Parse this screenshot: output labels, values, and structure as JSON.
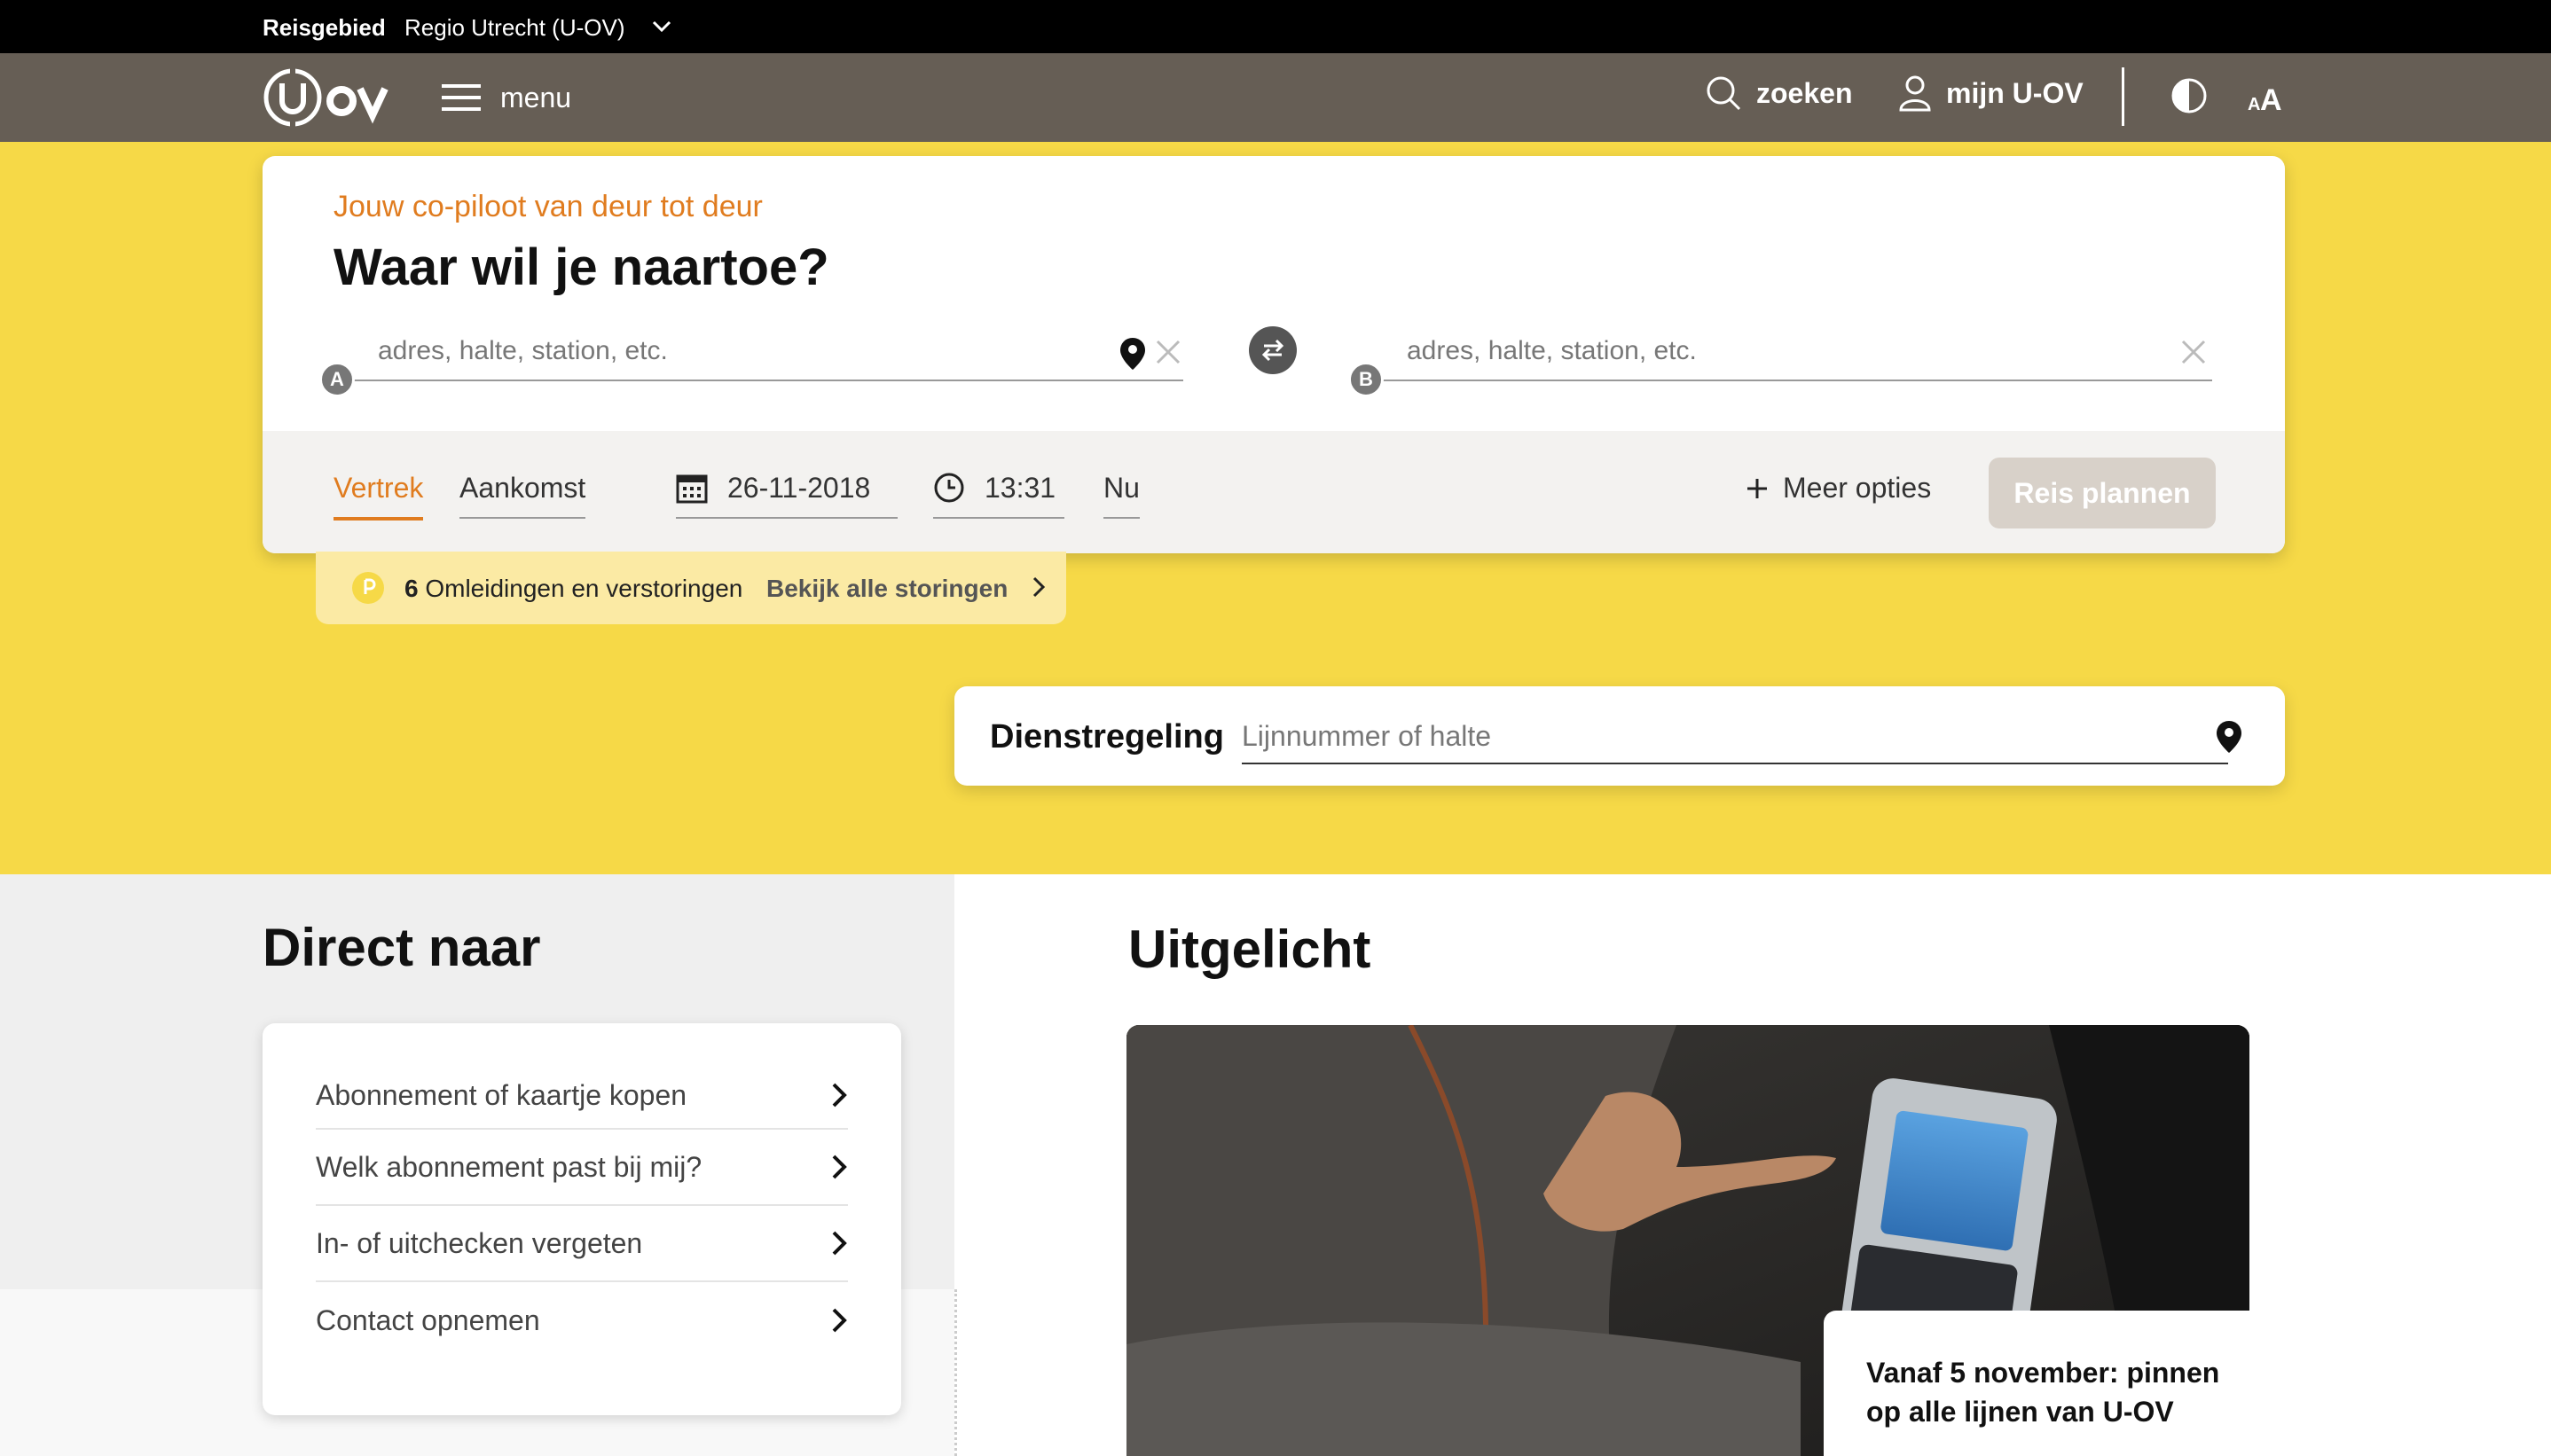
{
  "region": {
    "label": "Reisgebied",
    "value": "Regio Utrecht (U-OV)"
  },
  "nav": {
    "logo_alt": "U-OV",
    "menu_label": "menu",
    "search_label": "zoeken",
    "account_label": "mijn U-OV"
  },
  "planner": {
    "tagline": "Jouw co-piloot van deur tot deur",
    "heading": "Waar wil je naartoe?",
    "from": {
      "marker": "A",
      "placeholder": "adres, halte, station, etc.",
      "value": ""
    },
    "to": {
      "marker": "B",
      "placeholder": "adres, halte, station, etc.",
      "value": ""
    },
    "mode_options": [
      "Vertrek",
      "Aankomst"
    ],
    "selected_mode": "Vertrek",
    "date": "26-11-2018",
    "time": "13:31",
    "now_label": "Nu",
    "more_options": "Meer opties",
    "submit": "Reis plannen"
  },
  "disruptions": {
    "count": "6",
    "text": "Omleidingen en verstoringen",
    "link": "Bekijk alle storingen"
  },
  "timetable": {
    "title": "Dienstregeling",
    "placeholder": "Lijnnummer of halte",
    "value": ""
  },
  "direct": {
    "title": "Direct naar",
    "links": [
      "Abonnement of kaartje kopen",
      "Welk abonnement past bij mij?",
      "In- of uitchecken vergeten",
      "Contact opnemen"
    ]
  },
  "featured": {
    "title": "Uitgelicht",
    "caption": "Vanaf 5 november: pinnen op alle lijnen van U-OV"
  },
  "colors": {
    "region_bar": "#000000",
    "nav_bar": "#665e55",
    "hero_yellow": "#f6d947",
    "accent_orange": "#e07c1f",
    "disruption_bg": "#fbeaa4",
    "submit_disabled": "#d8d1c9"
  }
}
